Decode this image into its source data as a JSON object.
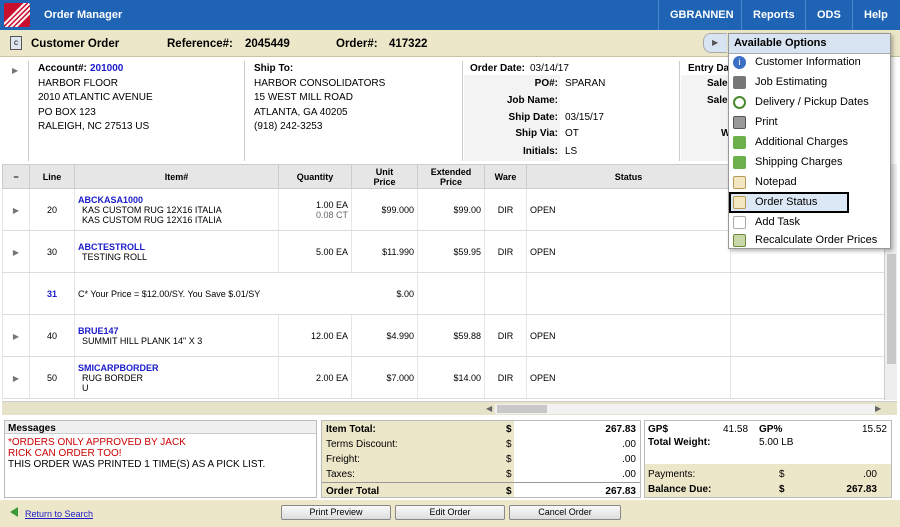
{
  "app": {
    "title": "Order Manager"
  },
  "nav": {
    "user": "GBRANNEN",
    "reports": "Reports",
    "ods": "ODS",
    "help": "Help"
  },
  "titlebar": {
    "page_title": "Customer Order",
    "reference_label": "Reference#:",
    "reference_value": "2045449",
    "order_label": "Order#:",
    "order_value": "417322"
  },
  "account": {
    "label": "Account#:",
    "number": "201000",
    "lines": [
      "HARBOR FLOOR",
      "2010 ATLANTIC AVENUE",
      "PO BOX 123",
      "RALEIGH, NC 27513 US"
    ]
  },
  "shipto": {
    "label": "Ship To:",
    "lines": [
      "HARBOR CONSOLIDATORS",
      "15 WEST MILL ROAD",
      "ATLANTA, GA 40205",
      "(918) 242-3253"
    ]
  },
  "order_info": {
    "order_date_label": "Order Date:",
    "order_date": "03/14/17",
    "po_label": "PO#:",
    "po": "SPARAN",
    "job_label": "Job Name:",
    "job": "",
    "ship_date_label": "Ship Date:",
    "ship_date": "03/15/17",
    "ship_via_label": "Ship Via:",
    "ship_via": "OT",
    "initials_label": "Initials:",
    "initials": "LS"
  },
  "entry": {
    "entry_label": "Entry Da",
    "sale1": "Sale",
    "sale2": "Sale",
    "w": "W"
  },
  "table": {
    "headers": {
      "toggle": "−",
      "line": "Line",
      "item": "Item#",
      "qty": "Quantity",
      "unit1": "Unit",
      "unit2": "Price",
      "ext1": "Extended",
      "ext2": "Price",
      "ware": "Ware",
      "status": "Status"
    },
    "rows": [
      {
        "line": "20",
        "item": "ABCKASA1000",
        "desc1": "KAS CUSTOM RUG 12X16 ITALIA",
        "desc2": "KAS CUSTOM RUG 12X16 ITALIA",
        "qty": "1.00 EA",
        "qty2": "0.08 CT",
        "unit": "$99.000",
        "ext": "$99.00",
        "ware": "DIR",
        "status": "OPEN"
      },
      {
        "line": "30",
        "item": "ABCTESTROLL",
        "desc1": "TESTING ROLL",
        "desc2": "",
        "qty": "5.00 EA",
        "qty2": "",
        "unit": "$11.990",
        "ext": "$59.95",
        "ware": "DIR",
        "status": "OPEN"
      },
      {
        "line": "31",
        "comment": "C* Your Price = $12.00/SY. You Save $.01/SY",
        "unit": "$.00"
      },
      {
        "line": "40",
        "item": "BRUE147",
        "desc1": "SUMMIT HILL PLANK 14\" X 3",
        "desc2": "",
        "qty": "12.00 EA",
        "qty2": "",
        "unit": "$4.990",
        "ext": "$59.88",
        "ware": "DIR",
        "status": "OPEN"
      },
      {
        "line": "50",
        "item": "SMICARPBORDER",
        "desc1": "RUG BORDER",
        "desc2": "U",
        "qty": "2.00 EA",
        "qty2": "",
        "unit": "$7.000",
        "ext": "$14.00",
        "ware": "DIR",
        "status": "OPEN"
      }
    ]
  },
  "messages": {
    "title": "Messages",
    "line1": "*ORDERS ONLY APPROVED BY JACK",
    "line2": "RICK CAN ORDER TOO!",
    "line3": "THIS ORDER WAS PRINTED 1 TIME(S) AS A PICK LIST."
  },
  "totals": {
    "item_total_label": "Item Total:",
    "item_total": "267.83",
    "terms_label": "Terms Discount:",
    "terms": ".00",
    "freight_label": "Freight:",
    "freight": ".00",
    "taxes_label": "Taxes:",
    "taxes": ".00",
    "order_total_label": "Order Total",
    "order_total": "267.83",
    "currency": "$"
  },
  "gp": {
    "gp_label": "GP$",
    "gp": "41.58",
    "gpp_label": "GP%",
    "gpp": "15.52",
    "weight_label": "Total Weight:",
    "weight": "5.00 LB",
    "payments_label": "Payments:",
    "payments": ".00",
    "balance_label": "Balance Due:",
    "balance": "267.83",
    "currency": "$"
  },
  "footer": {
    "return": "Return to Search",
    "print": "Print Preview",
    "edit": "Edit Order",
    "cancel": "Cancel Order"
  },
  "menu": {
    "title": "Available Options",
    "items": [
      "Customer Information",
      "Job Estimating",
      "Delivery / Pickup Dates",
      "Print",
      "Additional Charges",
      "Shipping Charges",
      "Notepad",
      "Order Status",
      "Add Task",
      "Recalculate Order Prices"
    ],
    "selected": "Order Status"
  },
  "colors": {
    "nav_blue": "#1e63b4",
    "link_blue": "#1a1acc",
    "alert_red": "#cc0000",
    "titlebar_tan": "#ede7c9"
  }
}
